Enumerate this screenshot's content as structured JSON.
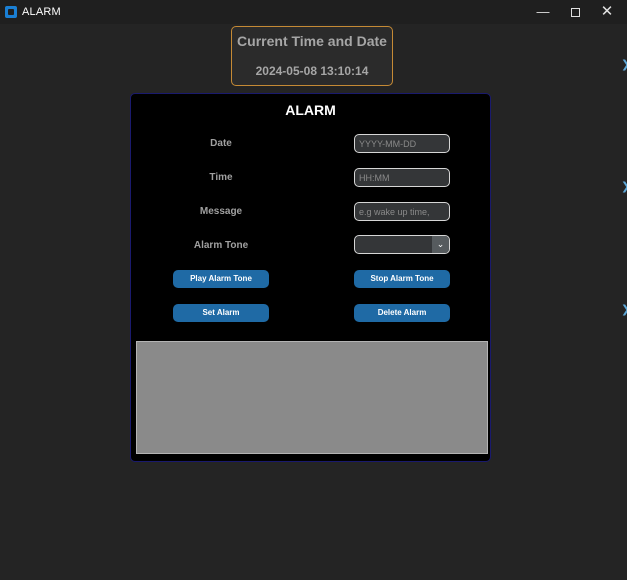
{
  "window": {
    "title": "ALARM",
    "minimize_glyph": "—",
    "close_glyph": "✕"
  },
  "clock": {
    "title": "Current Time and Date",
    "value": "2024-05-08 13:10:14"
  },
  "panel": {
    "title": "ALARM",
    "fields": {
      "date": {
        "label": "Date",
        "placeholder": "YYYY-MM-DD"
      },
      "time": {
        "label": "Time",
        "placeholder": "HH:MM"
      },
      "message": {
        "label": "Message",
        "placeholder": "e.g wake up time,"
      },
      "tone": {
        "label": "Alarm Tone",
        "value": ""
      }
    },
    "buttons": {
      "play": "Play Alarm Tone",
      "stop": "Stop Alarm Tone",
      "set": "Set Alarm",
      "delete": "Delete Alarm"
    }
  },
  "colors": {
    "accent_button": "#1f6aa5",
    "clock_border": "#c58a35",
    "panel_border": "#1a1a6e",
    "background": "#242424"
  }
}
